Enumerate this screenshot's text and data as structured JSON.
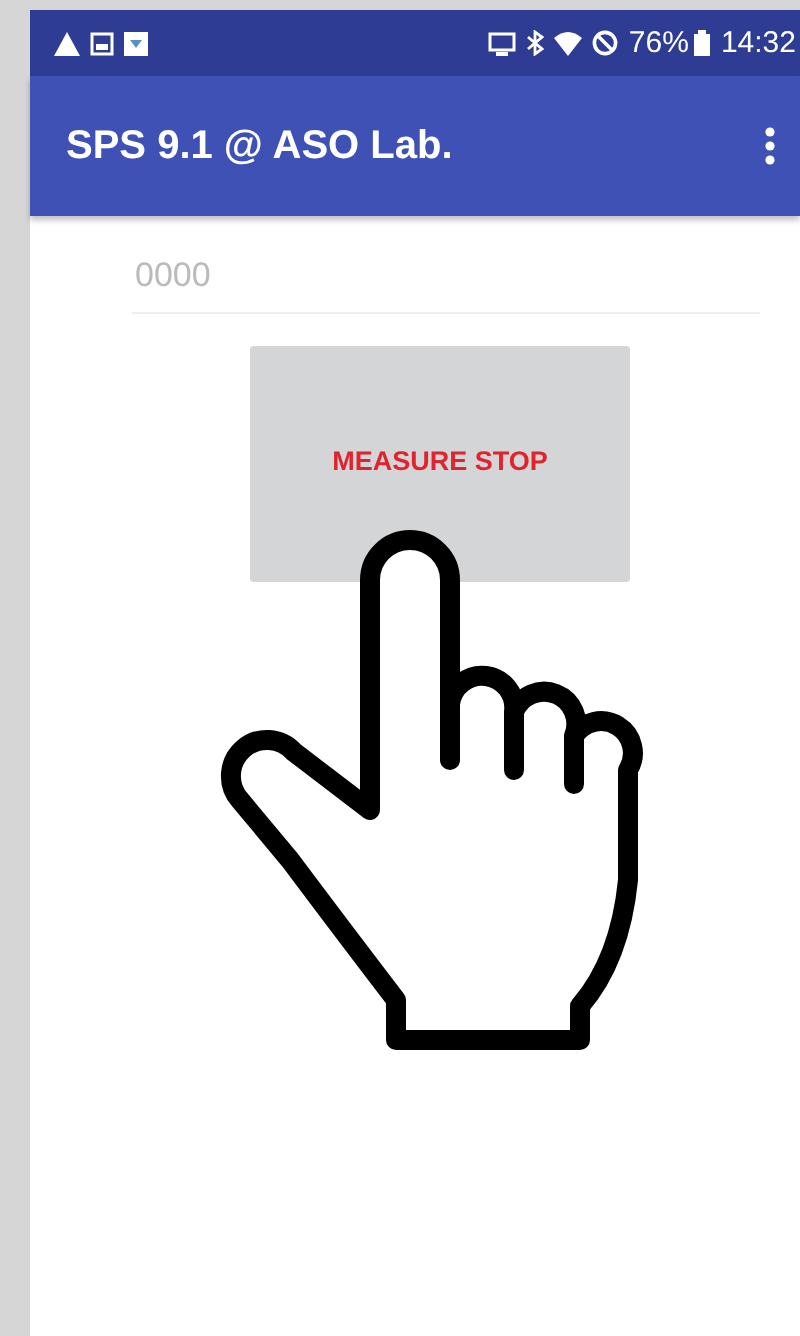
{
  "status_bar": {
    "battery": "76%",
    "time": "14:32"
  },
  "app_bar": {
    "title": "SPS 9.1 @ ASO Lab."
  },
  "field": {
    "placeholder": "0000"
  },
  "button": {
    "label": "MEASURE STOP"
  }
}
